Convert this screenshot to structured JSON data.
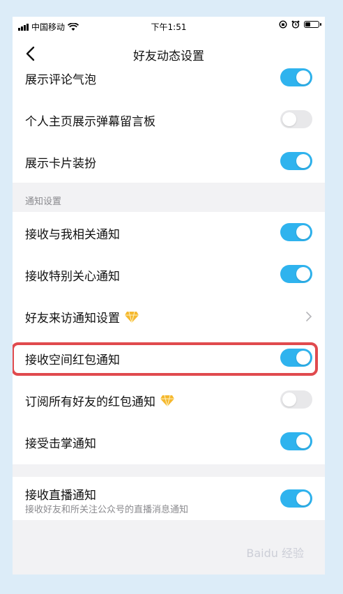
{
  "status_bar": {
    "carrier": "中国移动",
    "time": "下午1:51"
  },
  "nav": {
    "title": "好友动态设置"
  },
  "section_top": {
    "items": [
      {
        "label": "展示评论气泡",
        "on": true
      },
      {
        "label": "个人主页展示弹幕留言板",
        "on": false
      },
      {
        "label": "展示卡片装扮",
        "on": true
      }
    ]
  },
  "section_notify": {
    "header": "通知设置",
    "items": [
      {
        "label": "接收与我相关通知",
        "on": true
      },
      {
        "label": "接收特别关心通知",
        "on": true
      },
      {
        "label": "好友来访通知设置",
        "type": "link",
        "icon": "diamond-icon"
      },
      {
        "label": "接收空间红包通知",
        "on": true
      },
      {
        "label": "订阅所有好友的红包通知",
        "on": false,
        "icon": "diamond-icon"
      },
      {
        "label": "接受击掌通知",
        "on": true
      }
    ]
  },
  "section_live": {
    "items": [
      {
        "label": "接收直播通知",
        "sub": "接收好友和所关注公众号的直播消息通知",
        "on": true
      }
    ]
  },
  "colors": {
    "toggle_on": "#2fb3ee",
    "toggle_off": "#e8e8ea",
    "highlight": "#e04a4e"
  },
  "watermark": "Baidu 经验"
}
